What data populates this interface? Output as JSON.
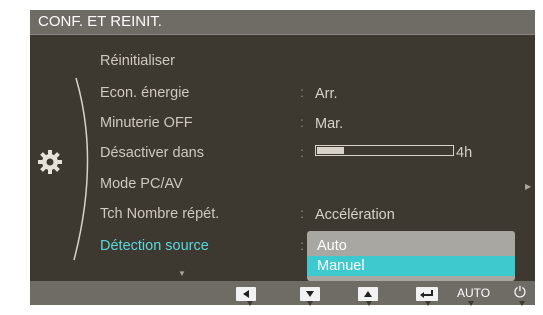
{
  "title": "CONF. ET REINIT.",
  "menu": {
    "items": [
      {
        "label": "Réinitialiser",
        "value": ""
      },
      {
        "label": "Econ. énergie",
        "value": "Arr."
      },
      {
        "label": "Minuterie OFF",
        "value": "Mar."
      },
      {
        "label": "Désactiver dans",
        "value": "4h"
      },
      {
        "label": "Mode PC/AV",
        "value": ""
      },
      {
        "label": "Tch Nombre répét.",
        "value": "Accélération"
      },
      {
        "label": "Détection source",
        "value": ""
      }
    ],
    "timer_progress": 0.2,
    "colon": ":",
    "more_right_icon": "small-right-triangle",
    "more_down_icon": "small-down-triangle"
  },
  "dropdown": {
    "options": [
      "Auto",
      "Manuel"
    ],
    "selected": "Manuel"
  },
  "buttons": {
    "left_icon": "left-arrow",
    "down_icon": "down-arrow",
    "up_icon": "up-arrow",
    "enter_icon": "enter",
    "auto_label": "AUTO",
    "power_icon": "power"
  },
  "colors": {
    "background": "#3d3830",
    "bar": "#6f6b65",
    "highlight": "#3ec9cf",
    "active_text": "#5ad8dc"
  }
}
